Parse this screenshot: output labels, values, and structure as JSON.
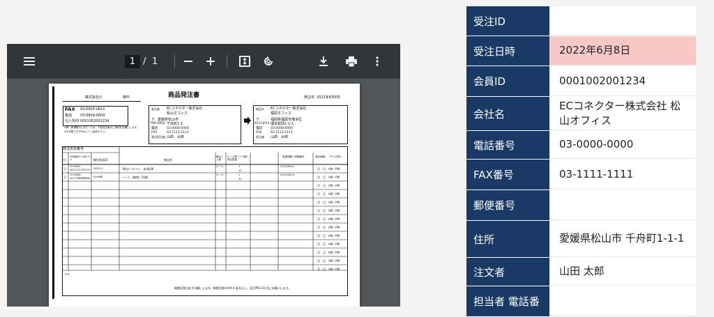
{
  "viewer": {
    "page_current": "1",
    "page_sep": "/",
    "page_total": "1"
  },
  "document": {
    "to_company": "株式会社久",
    "honorific": "御中",
    "title": "商品発注書",
    "order_date_label": "発注日",
    "order_date": "2022年6月8日",
    "fax_label": "FAX",
    "fax": "03-6809-0810",
    "tel_label": "電話",
    "tel": "03-6809-0809",
    "buyer_code_label": "仕入先ID",
    "buyer_code": "0001002001234",
    "notice1": "※弊、新規取引にあたっては、下記担当者のご承認をお願いします。",
    "notice2": "※お手数ですがFAXにてご返信下さい。",
    "orderer_label": "発注者",
    "orderer_name": "ECコネクター株式会社",
    "orderer_branch": "松山オフィス",
    "orderer_zip": "〒",
    "orderer_pref": "愛媛県松山市",
    "orderer_zipcode": "790-0952",
    "orderer_addr": "千舟町1-1",
    "orderer_tel_label": "電話",
    "orderer_tel": "03-0000-0000",
    "orderer_fax_label": "FAX",
    "orderer_fax": "03-1111-1111",
    "orderer_person_label": "発注担当者",
    "orderer_person": "山田　太郎",
    "ship_label": "納品先",
    "ship_name": "ECコネクター株式会社",
    "ship_branch": "福岡オフィス",
    "ship_zip": "〒",
    "ship_pref": "福岡県福岡市博多区",
    "ship_zipcode": "813-0011",
    "ship_addr": "博多駅前1-1-1",
    "ship_tel_label": "電話",
    "ship_tel": "03-0000-0000",
    "ship_fax_label": "FAX",
    "ship_fax": "03-1111-1111",
    "ship_person_label": "担当者",
    "ship_person": "山田　太郎",
    "order_no_label": "発注伝票番号",
    "col_no": "行",
    "col_jan": "FA商品ID / JANコード",
    "col_code": "御社商品ID",
    "col_name": "商品名",
    "col_unit": "単位 / 入数",
    "col_qty": "ケース数（バラ数） / 発注数量",
    "col_price": "希望納期 / 明細番号",
    "col_delivery": "指定納期 / （ 午入日時 ）",
    "row1_no": "1",
    "row1_jan": "1234567",
    "row1_jan2": "4511222333333",
    "row1_code": "000123",
    "row1_name": "3色ボールペン　赤/青/黒",
    "row1_unit": "ケース",
    "row1_qty": "1",
    "row1_qty2": "10",
    "row1_date": "2022/06/14",
    "row2_no": "2",
    "row2_jan": "1234568",
    "row2_jan2": "4577788888888",
    "row2_code": "000888",
    "row2_name": "ノート（無地）50枚",
    "row2_unit": "ケース",
    "row2_qty": "1",
    "row2_qty2": "30",
    "row2_date": "2022/06/14",
    "delivery_cell": "月　日　AM・PM",
    "memo_label": "メモ",
    "footer": "納期回答日必ずお願いします。納期回答をFAX Ⅱ 発注元へ、当日PM3:30 迄にお願いします。"
  },
  "info_table": {
    "rows": [
      {
        "label": "受注ID",
        "value": ""
      },
      {
        "label": "受注日時",
        "value": "2022年6月8日"
      },
      {
        "label": "会員ID",
        "value": "0001002001234"
      },
      {
        "label": "会社名",
        "value": "ECコネクター株式会社 松山オフィス"
      },
      {
        "label": "電話番号",
        "value": "03-0000-0000"
      },
      {
        "label": "FAX番号",
        "value": "03-1111-1111"
      },
      {
        "label": "郵便番号",
        "value": ""
      },
      {
        "label": "住所",
        "value": "愛媛県松山市 千舟町1-1-1"
      },
      {
        "label": "注文者",
        "value": "山田 太郎"
      },
      {
        "label": "担当者 電話番",
        "value": ""
      }
    ]
  },
  "colors": {
    "label_bg": "#1a3a66",
    "highlight": "#fac7c7",
    "toolbar": "#323639",
    "viewer_bg": "#525659"
  },
  "icons": [
    "menu-icon",
    "zoom-out-icon",
    "zoom-in-icon",
    "fit-page-icon",
    "rotate-icon",
    "download-icon",
    "print-icon",
    "more-icon"
  ]
}
